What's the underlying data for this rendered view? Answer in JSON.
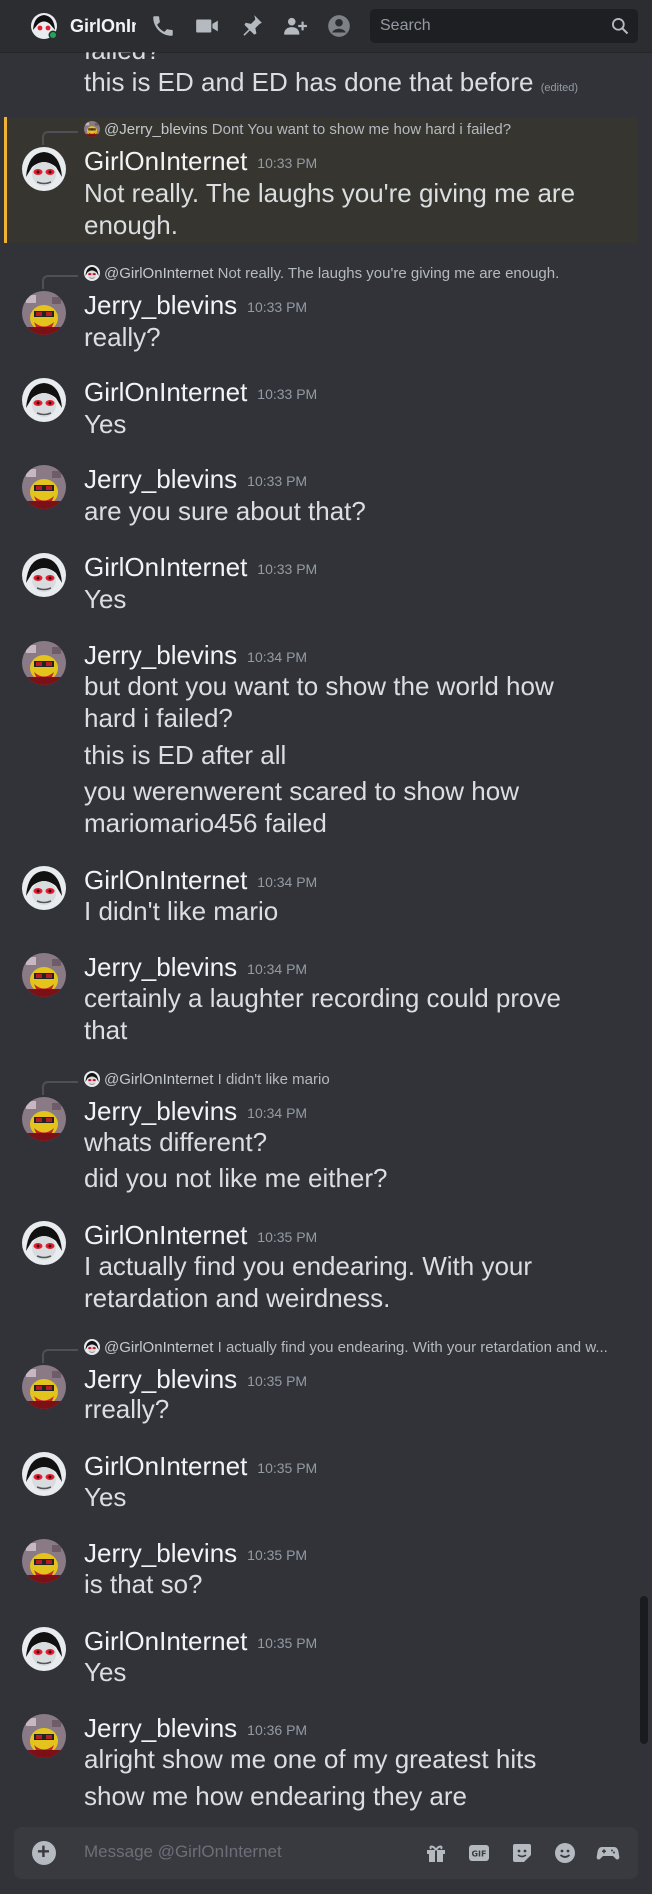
{
  "header": {
    "title": "GirlOnInternet",
    "search_placeholder": "Search",
    "icons": [
      "phone-icon",
      "video-icon",
      "pin-icon",
      "add-friends-icon",
      "profile-icon",
      "search-icon"
    ]
  },
  "top_partial": {
    "cut_text": "failed?",
    "text": "this is ED and ED has done that before",
    "edited": "(edited)"
  },
  "messages": [
    {
      "author": "GirlOnInternet",
      "time": "10:33 PM",
      "reply_name": "@Jerry_blevins",
      "reply_text": "Dont You want to show me how hard i failed?",
      "lines": [
        "Not really. The laughs you're giving me are",
        "enough."
      ]
    },
    {
      "author": "Jerry_blevins",
      "time": "10:33 PM",
      "reply_name": "@GirlOnInternet",
      "reply_text": "Not really. The laughs you're giving me are enough.",
      "lines": [
        "really?"
      ]
    },
    {
      "author": "GirlOnInternet",
      "time": "10:33 PM",
      "lines": [
        "Yes"
      ]
    },
    {
      "author": "Jerry_blevins",
      "time": "10:33 PM",
      "lines": [
        "are you sure about that?"
      ]
    },
    {
      "author": "GirlOnInternet",
      "time": "10:33 PM",
      "lines": [
        "Yes"
      ]
    },
    {
      "author": "Jerry_blevins",
      "time": "10:34 PM",
      "lines": [
        "but dont you want to show the world how",
        "hard i failed?",
        "this is ED after all",
        "you werenwerent scared to show how",
        "mariomario456 failed"
      ]
    },
    {
      "author": "GirlOnInternet",
      "time": "10:34 PM",
      "lines": [
        "I didn't like mario"
      ]
    },
    {
      "author": "Jerry_blevins",
      "time": "10:34 PM",
      "lines": [
        "certainly a laughter recording could prove",
        "that"
      ]
    },
    {
      "author": "Jerry_blevins",
      "time": "10:34 PM",
      "reply_name": "@GirlOnInternet",
      "reply_text": "I didn't like mario",
      "lines": [
        "whats different?",
        "did you not like me either?"
      ]
    },
    {
      "author": "GirlOnInternet",
      "time": "10:35 PM",
      "lines": [
        "I actually find you endearing. With your",
        "retardation and weirdness."
      ]
    },
    {
      "author": "Jerry_blevins",
      "time": "10:35 PM",
      "reply_name": "@GirlOnInternet",
      "reply_text": "I actually find you endearing. With your retardation and w...",
      "lines": [
        "rreally?"
      ]
    },
    {
      "author": "GirlOnInternet",
      "time": "10:35 PM",
      "lines": [
        "Yes"
      ]
    },
    {
      "author": "Jerry_blevins",
      "time": "10:35 PM",
      "lines": [
        "is that so?"
      ]
    },
    {
      "author": "GirlOnInternet",
      "time": "10:35 PM",
      "lines": [
        "Yes"
      ]
    },
    {
      "author": "Jerry_blevins",
      "time": "10:36 PM",
      "lines": [
        "alright show me one of my greatest hits",
        "show me how endearing they are"
      ]
    }
  ],
  "composer": {
    "placeholder": "Message @GirlOnInternet",
    "icons": [
      "gift-icon",
      "gif-icon",
      "sticker-icon",
      "emoji-icon",
      "activity-icon"
    ]
  },
  "colors": {
    "background": "#313338",
    "header": "#2b2d31",
    "highlight": "#f0b232",
    "online": "#23a559"
  }
}
